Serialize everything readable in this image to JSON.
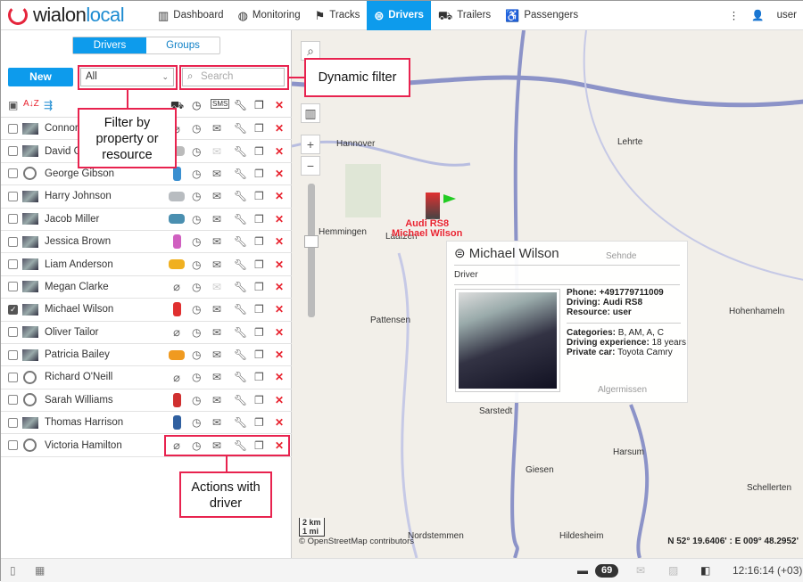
{
  "header": {
    "logo_a": "wialon",
    "logo_b": "local",
    "nav": [
      {
        "label": "Dashboard",
        "icon": "bar-chart-icon"
      },
      {
        "label": "Monitoring",
        "icon": "globe-icon"
      },
      {
        "label": "Tracks",
        "icon": "flag-icon"
      },
      {
        "label": "Drivers",
        "icon": "steering-wheel-icon",
        "active": true
      },
      {
        "label": "Trailers",
        "icon": "trailer-icon"
      },
      {
        "label": "Passengers",
        "icon": "passenger-icon"
      }
    ],
    "user": "user"
  },
  "panel": {
    "tabs": [
      "Drivers",
      "Groups"
    ],
    "active_tab": "Drivers",
    "new_label": "New",
    "filter_value": "All",
    "search_placeholder": "Search"
  },
  "drivers": [
    {
      "name": "Connor",
      "avatar": "photo",
      "vehicle": "none",
      "msg": true,
      "checked": false
    },
    {
      "name": "David G",
      "avatar": "photo",
      "vehicle": "#bbbbbb",
      "msg": false,
      "checked": false
    },
    {
      "name": "George Gibson",
      "avatar": "wheel",
      "vehicle": "#3a8fd0",
      "vertical": true,
      "msg": true,
      "checked": false
    },
    {
      "name": "Harry Johnson",
      "avatar": "photo",
      "vehicle": "#b8bcc0",
      "msg": true,
      "checked": false
    },
    {
      "name": "Jacob Miller",
      "avatar": "photo",
      "vehicle": "#4a8fb0",
      "msg": true,
      "checked": false
    },
    {
      "name": "Jessica Brown",
      "avatar": "photo",
      "vehicle": "#d060c0",
      "vertical": true,
      "msg": true,
      "checked": false
    },
    {
      "name": "Liam Anderson",
      "avatar": "photo",
      "vehicle": "#f0b020",
      "msg": true,
      "checked": false
    },
    {
      "name": "Megan Clarke",
      "avatar": "photo",
      "vehicle": "none",
      "msg": false,
      "checked": false
    },
    {
      "name": "Michael Wilson",
      "avatar": "photo",
      "vehicle": "#e03030",
      "vertical": true,
      "msg": true,
      "checked": true
    },
    {
      "name": "Oliver Tailor",
      "avatar": "photo",
      "vehicle": "none",
      "msg": true,
      "checked": false
    },
    {
      "name": "Patricia Bailey",
      "avatar": "photo",
      "vehicle": "#f09a20",
      "msg": true,
      "checked": false
    },
    {
      "name": "Richard O'Neill",
      "avatar": "wheel",
      "vehicle": "none",
      "msg": true,
      "checked": false
    },
    {
      "name": "Sarah Williams",
      "avatar": "wheel",
      "vehicle": "#d03030",
      "vertical": true,
      "msg": true,
      "checked": false
    },
    {
      "name": "Thomas Harrison",
      "avatar": "photo",
      "vehicle": "#3060a0",
      "vertical": true,
      "msg": true,
      "checked": false
    },
    {
      "name": "Victoria Hamilton",
      "avatar": "wheel",
      "vehicle": "none",
      "msg": true,
      "checked": false
    }
  ],
  "map": {
    "unit_label_a": "Audi RS8",
    "unit_label_b": "Michael Wilson",
    "places": [
      "Hannover",
      "Lehrte",
      "Hemmingen",
      "Laatzen",
      "Pattensen",
      "Sehnde",
      "Algermissen",
      "Hohenhameln",
      "Sarstedt",
      "Giesen",
      "Harsum",
      "Schellerten",
      "Nordstemmen",
      "Hildesheim"
    ],
    "scale_km": "2 km",
    "scale_mi": "1 mi",
    "attribution": "© OpenStreetMap contributors",
    "coords": "N 52° 19.6406' : E 009° 48.2952'"
  },
  "popup": {
    "name": "Michael Wilson",
    "role": "Driver",
    "phone": "+491779711009",
    "driving": "Audi RS8",
    "resource": "user",
    "categories": "B, AM, A, C",
    "experience": "18 years",
    "private_car": "Toyota Camry",
    "l_phone": "Phone:",
    "l_driving": "Driving:",
    "l_resource": "Resource:",
    "l_categories": "Categories:",
    "l_experience": "Driving experience:",
    "l_car": "Private car:"
  },
  "bottom": {
    "notifications": "69",
    "time": "12:16:14 (+03)"
  },
  "callouts": {
    "dynamic": "Dynamic filter",
    "filter": "Filter by property or resource",
    "actions": "Actions with driver"
  }
}
